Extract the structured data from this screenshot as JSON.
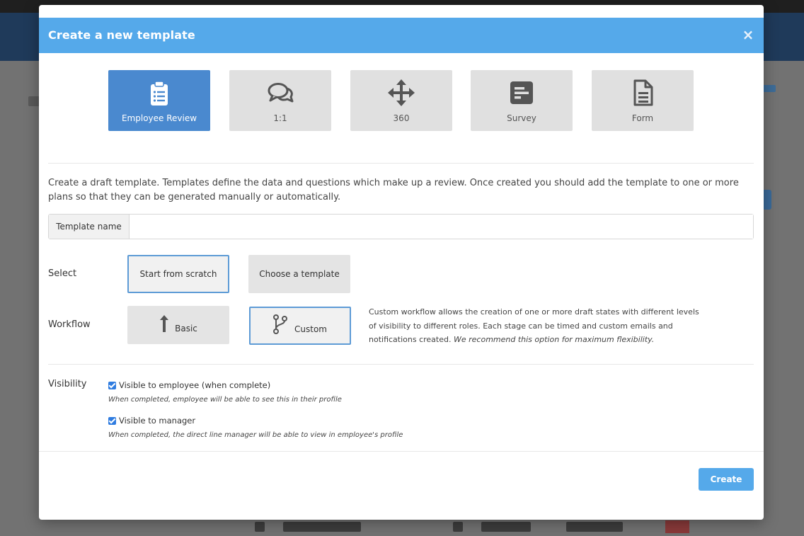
{
  "modal": {
    "title": "Create a new template",
    "close_label": "×"
  },
  "template_types": [
    {
      "label": "Employee Review",
      "icon": "clipboard-list-icon",
      "active": true
    },
    {
      "label": "1:1",
      "icon": "chat-bubbles-icon",
      "active": false
    },
    {
      "label": "360",
      "icon": "move-arrows-icon",
      "active": false
    },
    {
      "label": "Survey",
      "icon": "survey-icon",
      "active": false
    },
    {
      "label": "Form",
      "icon": "document-icon",
      "active": false
    }
  ],
  "description": "Create a draft template. Templates define the data and questions which make up a review. Once created you should add the template to one or more plans so that they can be generated manually or automatically.",
  "template_name": {
    "label": "Template name",
    "value": "",
    "placeholder": ""
  },
  "select": {
    "label": "Select",
    "options": [
      {
        "label": "Start from scratch",
        "selected": true
      },
      {
        "label": "Choose a template",
        "selected": false
      }
    ]
  },
  "workflow": {
    "label": "Workflow",
    "options": [
      {
        "label": "Basic",
        "icon": "arrow-up-icon",
        "selected": false
      },
      {
        "label": "Custom",
        "icon": "branch-icon",
        "selected": true
      }
    ],
    "note": "Custom workflow allows the creation of one or more draft states with different levels of visibility to different roles. Each stage can be timed and custom emails and notifications created.",
    "note_emphasis": "We recommend this option for maximum flexibility."
  },
  "visibility": {
    "label": "Visibility",
    "items": [
      {
        "label": "Visible to employee (when complete)",
        "checked": true,
        "help": "When completed, employee will be able to see this in their profile"
      },
      {
        "label": "Visible to manager",
        "checked": true,
        "help": "When completed, the direct line manager will be able to view in employee's profile"
      }
    ]
  },
  "footer": {
    "create_label": "Create"
  },
  "colors": {
    "header": "#55a9ea",
    "active_card": "#4a89cf",
    "selected_border": "#5d9bd6",
    "checkbox": "#2f7ce0"
  }
}
